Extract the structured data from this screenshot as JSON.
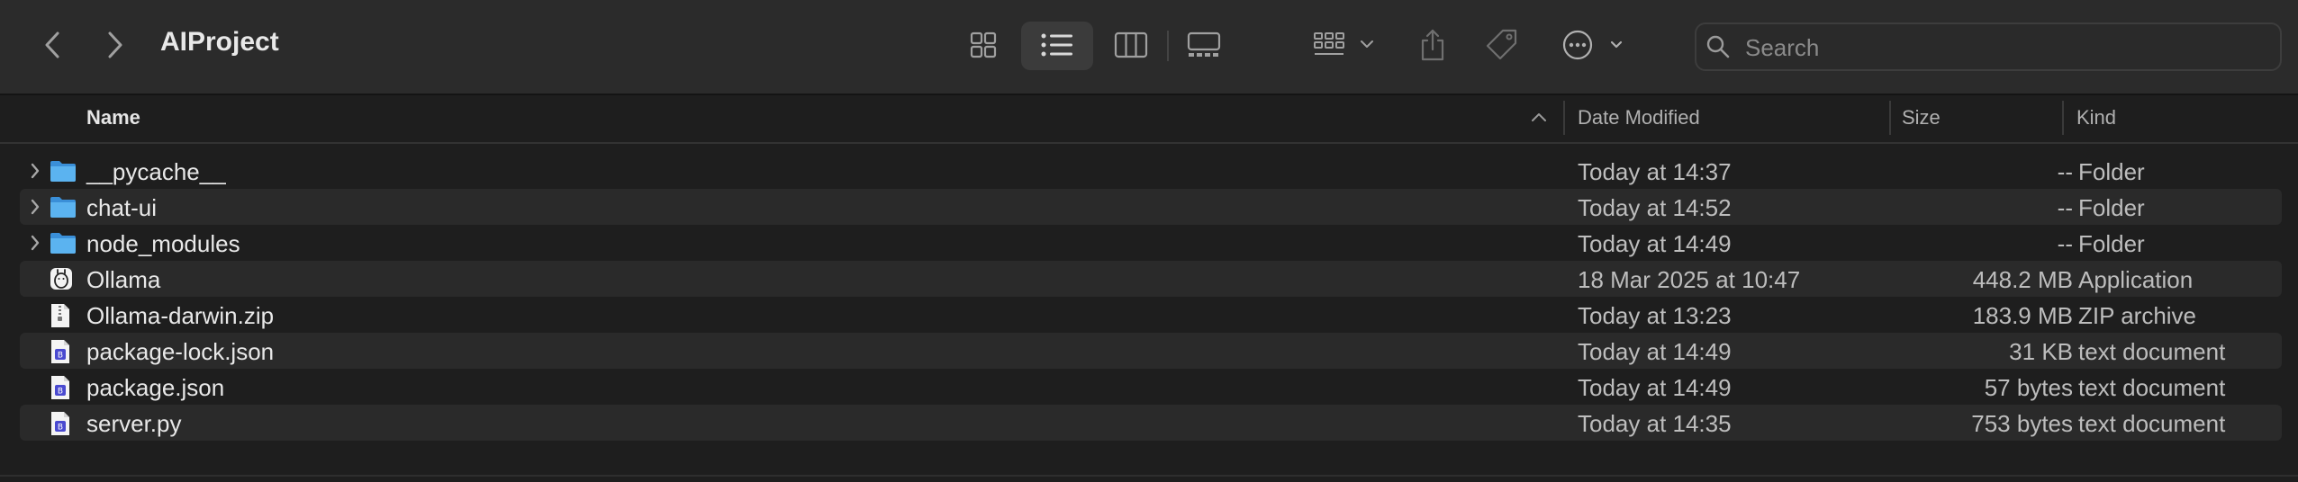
{
  "window": {
    "title": "AIProject"
  },
  "toolbar": {
    "back_icon": "chevron-left-icon",
    "forward_icon": "chevron-right-icon",
    "view_modes": [
      "icon-view",
      "list-view",
      "column-view",
      "gallery-view"
    ],
    "selected_view": "list-view",
    "group_icon": "group-by-icon",
    "share_icon": "share-icon",
    "tag_icon": "tag-icon",
    "more_icon": "ellipsis-circle-icon"
  },
  "search": {
    "placeholder": "Search",
    "value": ""
  },
  "columns": {
    "name": "Name",
    "date": "Date Modified",
    "size": "Size",
    "kind": "Kind",
    "sort_indicator": "ascending"
  },
  "files": [
    {
      "name": "__pycache__",
      "date": "Today at 14:37",
      "size": "--",
      "kind": "Folder",
      "icon": "folder-icon",
      "expandable": true
    },
    {
      "name": "chat-ui",
      "date": "Today at 14:52",
      "size": "--",
      "kind": "Folder",
      "icon": "folder-icon",
      "expandable": true
    },
    {
      "name": "node_modules",
      "date": "Today at 14:49",
      "size": "--",
      "kind": "Folder",
      "icon": "folder-icon",
      "expandable": true
    },
    {
      "name": "Ollama",
      "date": "18 Mar 2025 at 10:47",
      "size": "448.2 MB",
      "kind": "Application",
      "icon": "app-icon",
      "expandable": false
    },
    {
      "name": "Ollama-darwin.zip",
      "date": "Today at 13:23",
      "size": "183.9 MB",
      "kind": "ZIP archive",
      "icon": "zip-file-icon",
      "expandable": false
    },
    {
      "name": "package-lock.json",
      "date": "Today at 14:49",
      "size": "31 KB",
      "kind": "text document",
      "icon": "document-icon",
      "expandable": false
    },
    {
      "name": "package.json",
      "date": "Today at 14:49",
      "size": "57 bytes",
      "kind": "text document",
      "icon": "document-icon",
      "expandable": false
    },
    {
      "name": "server.py",
      "date": "Today at 14:35",
      "size": "753 bytes",
      "kind": "text document",
      "icon": "document-icon",
      "expandable": false
    }
  ],
  "colors": {
    "accent_folder": "#4aa3e8",
    "background": "#1e1e1e",
    "toolbar": "#2b2b2b"
  }
}
